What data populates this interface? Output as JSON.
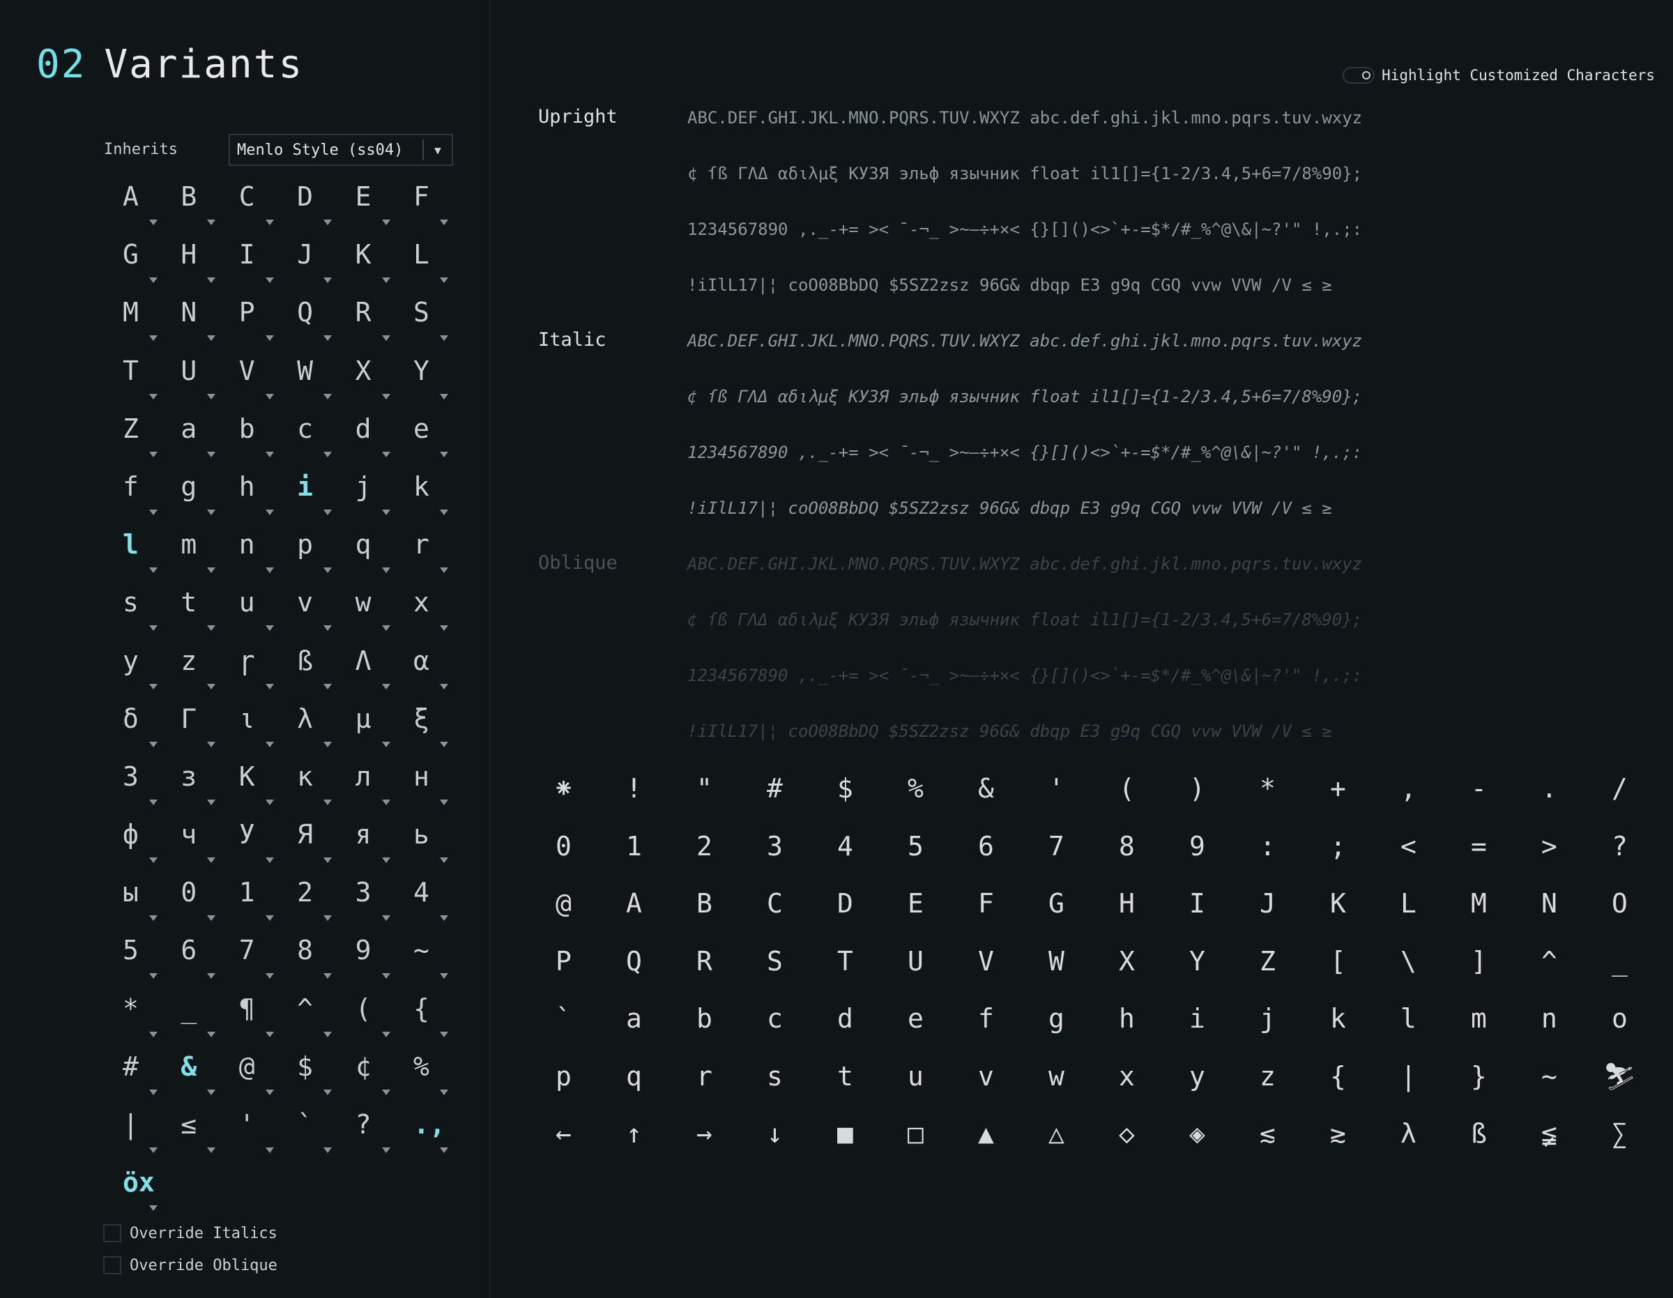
{
  "sidebar": {
    "title_num": "02",
    "title": "Variants",
    "inherits_label": "Inherits",
    "inherits_value": "Menlo Style (ss04)",
    "cells": [
      {
        "g": "A",
        "hl": false
      },
      {
        "g": "B",
        "hl": false
      },
      {
        "g": "C",
        "hl": false
      },
      {
        "g": "D",
        "hl": false
      },
      {
        "g": "E",
        "hl": false
      },
      {
        "g": "F",
        "hl": false
      },
      {
        "g": "G",
        "hl": false
      },
      {
        "g": "H",
        "hl": false
      },
      {
        "g": "I",
        "hl": false
      },
      {
        "g": "J",
        "hl": false
      },
      {
        "g": "K",
        "hl": false
      },
      {
        "g": "L",
        "hl": false
      },
      {
        "g": "M",
        "hl": false
      },
      {
        "g": "N",
        "hl": false
      },
      {
        "g": "P",
        "hl": false
      },
      {
        "g": "Q",
        "hl": false
      },
      {
        "g": "R",
        "hl": false
      },
      {
        "g": "S",
        "hl": false
      },
      {
        "g": "T",
        "hl": false
      },
      {
        "g": "U",
        "hl": false
      },
      {
        "g": "V",
        "hl": false
      },
      {
        "g": "W",
        "hl": false
      },
      {
        "g": "X",
        "hl": false
      },
      {
        "g": "Y",
        "hl": false
      },
      {
        "g": "Z",
        "hl": false
      },
      {
        "g": "a",
        "hl": false
      },
      {
        "g": "b",
        "hl": false
      },
      {
        "g": "c",
        "hl": false
      },
      {
        "g": "d",
        "hl": false
      },
      {
        "g": "e",
        "hl": false
      },
      {
        "g": "f",
        "hl": false
      },
      {
        "g": "g",
        "hl": false
      },
      {
        "g": "h",
        "hl": false
      },
      {
        "g": "i",
        "hl": true
      },
      {
        "g": "j",
        "hl": false
      },
      {
        "g": "k",
        "hl": false
      },
      {
        "g": "l",
        "hl": true
      },
      {
        "g": "m",
        "hl": false
      },
      {
        "g": "n",
        "hl": false
      },
      {
        "g": "p",
        "hl": false
      },
      {
        "g": "q",
        "hl": false
      },
      {
        "g": "r",
        "hl": false
      },
      {
        "g": "s",
        "hl": false
      },
      {
        "g": "t",
        "hl": false
      },
      {
        "g": "u",
        "hl": false
      },
      {
        "g": "v",
        "hl": false
      },
      {
        "g": "w",
        "hl": false
      },
      {
        "g": "x",
        "hl": false
      },
      {
        "g": "y",
        "hl": false
      },
      {
        "g": "z",
        "hl": false
      },
      {
        "g": "ɼ",
        "hl": false
      },
      {
        "g": "ß",
        "hl": false
      },
      {
        "g": "Λ",
        "hl": false
      },
      {
        "g": "α",
        "hl": false
      },
      {
        "g": "δ",
        "hl": false
      },
      {
        "g": "Γ",
        "hl": false
      },
      {
        "g": "ι",
        "hl": false
      },
      {
        "g": "λ",
        "hl": false
      },
      {
        "g": "μ",
        "hl": false
      },
      {
        "g": "ξ",
        "hl": false
      },
      {
        "g": "З",
        "hl": false
      },
      {
        "g": "з",
        "hl": false
      },
      {
        "g": "К",
        "hl": false
      },
      {
        "g": "к",
        "hl": false
      },
      {
        "g": "л",
        "hl": false
      },
      {
        "g": "н",
        "hl": false
      },
      {
        "g": "ф",
        "hl": false
      },
      {
        "g": "ч",
        "hl": false
      },
      {
        "g": "У",
        "hl": false
      },
      {
        "g": "Я",
        "hl": false
      },
      {
        "g": "я",
        "hl": false
      },
      {
        "g": "ь",
        "hl": false
      },
      {
        "g": "ы",
        "hl": false
      },
      {
        "g": "0",
        "hl": false
      },
      {
        "g": "1",
        "hl": false
      },
      {
        "g": "2",
        "hl": false
      },
      {
        "g": "3",
        "hl": false
      },
      {
        "g": "4",
        "hl": false
      },
      {
        "g": "5",
        "hl": false
      },
      {
        "g": "6",
        "hl": false
      },
      {
        "g": "7",
        "hl": false
      },
      {
        "g": "8",
        "hl": false
      },
      {
        "g": "9",
        "hl": false
      },
      {
        "g": "~",
        "hl": false
      },
      {
        "g": "*",
        "hl": false
      },
      {
        "g": "_",
        "hl": false
      },
      {
        "g": "¶",
        "hl": false
      },
      {
        "g": "^",
        "hl": false
      },
      {
        "g": "(",
        "hl": false
      },
      {
        "g": "{",
        "hl": false
      },
      {
        "g": "#",
        "hl": false
      },
      {
        "g": "&",
        "hl": true
      },
      {
        "g": "@",
        "hl": false
      },
      {
        "g": "$",
        "hl": false
      },
      {
        "g": "¢",
        "hl": false
      },
      {
        "g": "%",
        "hl": false
      },
      {
        "g": "|",
        "hl": false
      },
      {
        "g": "≤",
        "hl": false
      },
      {
        "g": "'",
        "hl": false
      },
      {
        "g": "`",
        "hl": false
      },
      {
        "g": "?",
        "hl": false
      },
      {
        "g": ".,",
        "hl": true
      },
      {
        "g": "öx",
        "hl": true
      }
    ],
    "override_italics": "Override Italics",
    "override_oblique": "Override Oblique"
  },
  "toggle_label": "Highlight Customized Characters",
  "samples": [
    {
      "label": "Upright",
      "style": "upright",
      "lines": [
        "ABC.DEF.GHI.JKL.MNO.PQRS.TUV.WXYZ abc.def.ghi.jkl.mno.pqrs.tuv.wxyz",
        "¢ ſß ΓΛΔ αδιλμξ КУЗЯ эльф язычник float il1[]={1-2/3.4,5+6=7/8%90};",
        "1234567890 ,._-+= >< ¯-¬_ >~–÷+×< {}[]()<>`+-=$*/#_%^@\\&|~?'\" !,.;:",
        "!iIlL17|¦ coO08BbDQ $5SZ2zsz 96G& dbqp E3 g9q CGQ vvw VVW /V ≤ ≥"
      ]
    },
    {
      "label": "Italic",
      "style": "italic",
      "lines": [
        "ABC.DEF.GHI.JKL.MNO.PQRS.TUV.WXYZ abc.def.ghi.jkl.mno.pqrs.tuv.wxyz",
        "¢ ſß ΓΛΔ αδιλμξ КУЗЯ эльф язычник float il1[]={1-2/3.4,5+6=7/8%90};",
        "1234567890 ,._-+= >< ¯-¬_ >~–÷+×< {}[]()<>`+-=$*/#_%^@\\&|~?'\" !,.;:",
        "!iIlL17|¦ coO08BbDQ $5SZ2zsz 96G& dbqp E3 g9q CGQ vvw VVW /V ≤ ≥"
      ]
    },
    {
      "label": "Oblique",
      "style": "oblique",
      "lines": [
        "ABC.DEF.GHI.JKL.MNO.PQRS.TUV.WXYZ abc.def.ghi.jkl.mno.pqrs.tuv.wxyz",
        "¢ ſß ΓΛΔ αδιλμξ КУЗЯ эльф язычник float il1[]={1-2/3.4,5+6=7/8%90};",
        "1234567890 ,._-+= >< ¯-¬_ >~–÷+×< {}[]()<>`+-=$*/#_%^@\\&|~?'\" !,.;:",
        "!iIlL17|¦ coO08BbDQ $5SZ2zsz 96G& dbqp E3 g9q CGQ vvw VVW /V ≤ ≥"
      ]
    }
  ],
  "charmap": [
    "⁕",
    "!",
    "\"",
    "#",
    "$",
    "%",
    "&",
    "'",
    "(",
    ")",
    "*",
    "+",
    ",",
    "-",
    ".",
    "/",
    "0",
    "1",
    "2",
    "3",
    "4",
    "5",
    "6",
    "7",
    "8",
    "9",
    ":",
    ";",
    "<",
    "=",
    ">",
    "?",
    "@",
    "A",
    "B",
    "C",
    "D",
    "E",
    "F",
    "G",
    "H",
    "I",
    "J",
    "K",
    "L",
    "M",
    "N",
    "O",
    "P",
    "Q",
    "R",
    "S",
    "T",
    "U",
    "V",
    "W",
    "X",
    "Y",
    "Z",
    "[",
    "\\",
    "]",
    "^",
    "_",
    "`",
    "a",
    "b",
    "c",
    "d",
    "e",
    "f",
    "g",
    "h",
    "i",
    "j",
    "k",
    "l",
    "m",
    "n",
    "o",
    "p",
    "q",
    "r",
    "s",
    "t",
    "u",
    "v",
    "w",
    "x",
    "y",
    "z",
    "{",
    "|",
    "}",
    "~",
    "⛷",
    "←",
    "↑",
    "→",
    "↓",
    "■",
    "□",
    "▲",
    "△",
    "◇",
    "◈",
    "≲",
    "≳",
    "λ",
    "ß",
    "≨",
    "∑"
  ]
}
